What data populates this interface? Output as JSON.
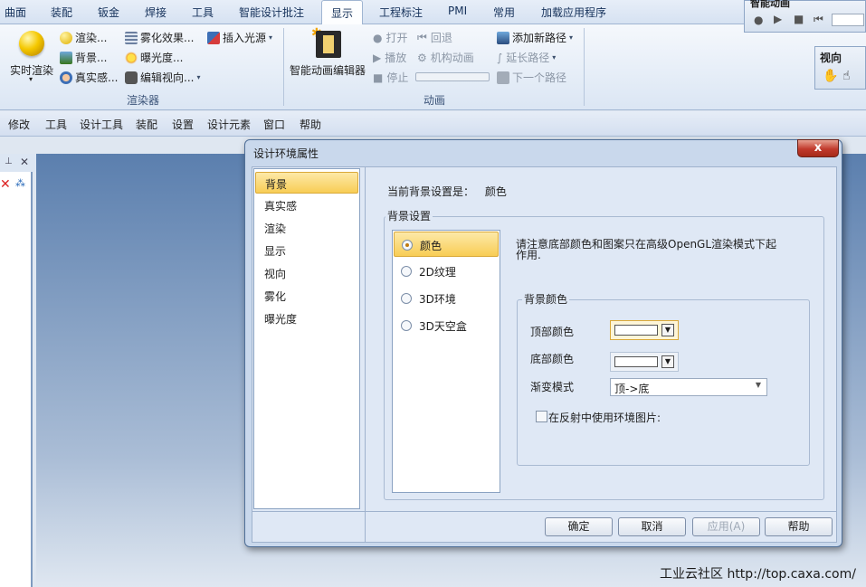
{
  "ribbon_tabs": [
    "曲面",
    "装配",
    "钣金",
    "焊接",
    "工具",
    "智能设计批注",
    "显示",
    "工程标注",
    "PMI",
    "常用",
    "加载应用程序"
  ],
  "ribbon": {
    "renderer": {
      "big_label": "实时渲染",
      "items": [
        "渲染...",
        "背景...",
        "真实感...",
        "雾化效果...",
        "曝光度...",
        "编辑视向...",
        "插入光源"
      ],
      "group_label": "渲染器"
    },
    "animation": {
      "big_label": "智能动画编辑器",
      "items": [
        "打开",
        "播放",
        "停止",
        "回退",
        "机构动画",
        "添加新路径",
        "延长路径",
        "下一个路径"
      ],
      "group_label": "动画"
    },
    "anim_panel_title": "智能动画",
    "view_panel_title": "视向"
  },
  "menubar": [
    "修改",
    "工具",
    "设计工具",
    "装配",
    "设置",
    "设计元素",
    "窗口",
    "帮助"
  ],
  "dialog": {
    "title": "设计环境属性",
    "close_label": "x",
    "nav_items": [
      "背景",
      "真实感",
      "渲染",
      "显示",
      "视向",
      "雾化",
      "曝光度"
    ],
    "current_setting_label": "当前背景设置是：",
    "current_setting_value": "颜色",
    "bg_settings_legend": "背景设置",
    "options": [
      "颜色",
      "2D纹理",
      "3D环境",
      "3D天空盒"
    ],
    "note": "请注意底部颜色和图案只在高级OpenGL渲染模式下起作用.",
    "bg_color_legend": "背景颜色",
    "top_color_label": "顶部颜色",
    "bottom_color_label": "底部颜色",
    "gradient_label": "渐变模式",
    "gradient_value": "顶->底",
    "reflect_label": "在反射中使用环境图片:",
    "buttons": {
      "ok": "确定",
      "cancel": "取消",
      "apply": "应用(A)",
      "help": "帮助"
    }
  },
  "footer_text": "工业云社区 http://top.caxa.com/",
  "colors": {
    "selection": "#f8cd55",
    "dialog_bg": "#dfe8f5",
    "close_button": "#c0392b"
  }
}
